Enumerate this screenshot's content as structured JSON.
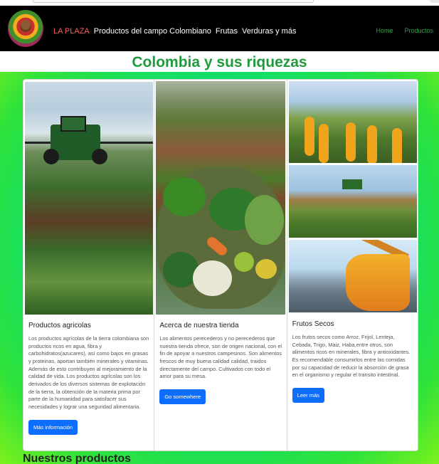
{
  "navbar": {
    "brand": "LA PLAZA",
    "links": [
      "Productos del campo Colombiano",
      "Frutas",
      "Verduras y más"
    ],
    "right_links": [
      "Home",
      "Productos"
    ],
    "colors": {
      "background": "#000000",
      "brand": "#ff5b5b",
      "links": "#ffffff",
      "right_links": "#28a745"
    }
  },
  "page": {
    "title": "Colombia y sus riquezas",
    "title_color": "#1f9b3d"
  },
  "cards": [
    {
      "title": "Productos agricolas",
      "text": "Los productos agrícolas de la tierra colombiana son productos ricos en agua, fibra y carbohidratos(azucares), así como bajos en grasas y proteinas, aportan también minerales y vitaminas. Además de esto contribuyen al mejoramiento de la calidad de vida. Los productos agrícolas son los derivados de los diversos sistemas de explotación de la tierra, la obtención de la materia prima por parte de la humanidad para satisfacer sus necesidades y lograr una seguridad alimentaria.",
      "button": "Más información"
    },
    {
      "title": "Acerca de nuestra tienda",
      "text": "Los alimentos perecederos y no perecederos que nuestra tienda ofrece, son de origen nacional, con el fin de apoyar a nuestros campesinos. Son alimentos frescos de muy buena calidad calidad, traidos directamente del campo. Cultivados con todo el amor para su mesa.",
      "button": "Go somewhere"
    },
    {
      "title": "Frutos Secos",
      "text": "Los frutos secos como Arroz, Frijol, Lenteja, Cebada, Trigo, Maiz, Haba,entre otros, son alimentos ricos en minerales, fibra y antioxidantes. Es recomendable consumirlos entre las comidas por su capacidad de reducir la absorción de grasa en el organismo y regular el transito intestinal.",
      "button": "Leer más"
    }
  ],
  "section": {
    "products_title": "Nuestros productos"
  },
  "button_color": "#0d6efd"
}
